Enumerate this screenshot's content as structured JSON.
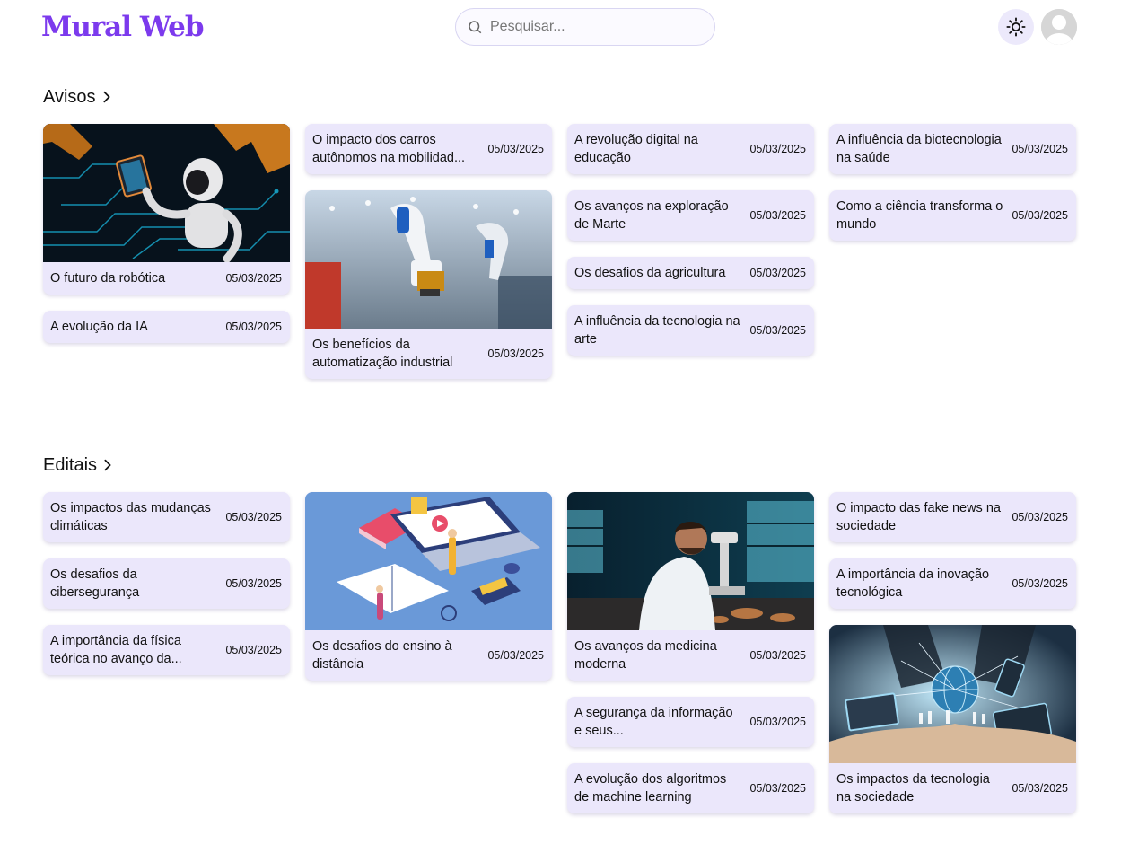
{
  "header": {
    "logo": "Mural Web",
    "search_placeholder": "Pesquisar..."
  },
  "icons": {
    "search": "search-icon",
    "theme": "sun-icon",
    "avatar": "user-avatar-icon",
    "chevron": "chevron-right-icon"
  },
  "colors": {
    "brand": "#7c3aed",
    "card": "#ebe7fb"
  },
  "avisos": {
    "title": "Avisos",
    "cards": [
      {
        "title": "O futuro da robótica",
        "date": "05/03/2025",
        "image": "robot-tablet"
      },
      {
        "title": "A evolução da IA",
        "date": "05/03/2025"
      },
      {
        "title": "O impacto dos carros autônomos na mobilidad...",
        "date": "05/03/2025"
      },
      {
        "title": "Os benefícios da automatização industrial",
        "date": "05/03/2025",
        "image": "industrial-robot-arm"
      },
      {
        "title": "A revolução digital na educação",
        "date": "05/03/2025"
      },
      {
        "title": "Os avanços na exploração de Marte",
        "date": "05/03/2025"
      },
      {
        "title": "Os desafios da agricultura",
        "date": "05/03/2025"
      },
      {
        "title": "A influência da tecnologia na arte",
        "date": "05/03/2025"
      },
      {
        "title": "A influência da biotecnologia na saúde",
        "date": "05/03/2025"
      },
      {
        "title": "Como a ciência transforma o mundo",
        "date": "05/03/2025"
      }
    ]
  },
  "editais": {
    "title": "Editais",
    "cards": [
      {
        "title": "Os impactos das mudanças climáticas",
        "date": "05/03/2025"
      },
      {
        "title": "Os desafios da cibersegurança",
        "date": "05/03/2025"
      },
      {
        "title": "A importância da física teórica no avanço da...",
        "date": "05/03/2025"
      },
      {
        "title": "Os desafios do ensino à distância",
        "date": "05/03/2025",
        "image": "online-learning-illustration"
      },
      {
        "title": "Os avanços da medicina moderna",
        "date": "05/03/2025",
        "image": "scientist-microscope"
      },
      {
        "title": "A segurança da informação e seus...",
        "date": "05/03/2025"
      },
      {
        "title": "A evolução dos algoritmos de machine learning",
        "date": "05/03/2025"
      },
      {
        "title": "O impacto das fake news na sociedade",
        "date": "05/03/2025"
      },
      {
        "title": "A importância da inovação tecnológica",
        "date": "05/03/2025"
      },
      {
        "title": "Os impactos da tecnologia na sociedade",
        "date": "05/03/2025",
        "image": "hands-global-network"
      }
    ]
  }
}
